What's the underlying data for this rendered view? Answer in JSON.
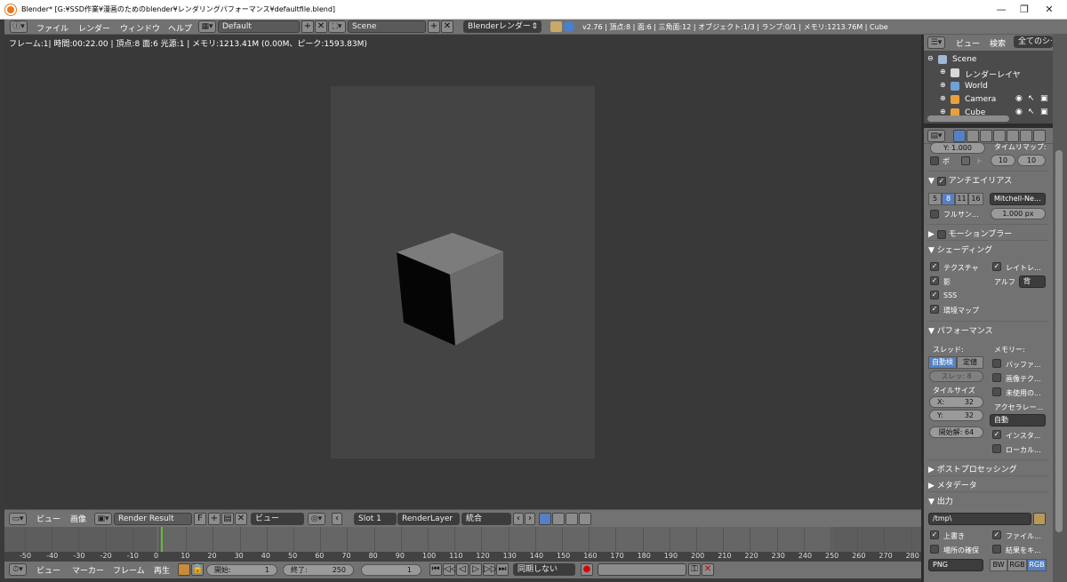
{
  "window": {
    "title": "Blender* [G:¥SSD作業¥漫画のためのblender¥レンダリングパフォーマンス¥defaultfile.blend]",
    "minimize": "—",
    "maximize": "❐",
    "close": "✕"
  },
  "menu": {
    "file": "ファイル",
    "render": "レンダー",
    "window": "ウィンドウ",
    "help": "ヘルプ"
  },
  "header": {
    "layout": "Default",
    "scene": "Scene",
    "engine": "Blenderレンダー",
    "stats": "v2.76 | 頂点:8 | 面:6 | 三角面:12 | オブジェクト:1/3 | ランプ:0/1 | メモリ:1213.76M | Cube"
  },
  "viewport": {
    "info": "フレーム:1| 時間:00:22.00 | 頂点:8 面:6 光源:1 | メモリ:1213.41M (0.00M、ピーク:1593.83M)"
  },
  "image_editor": {
    "view": "ビュー",
    "image": "画像",
    "image_name": "Render Result",
    "fake": "F",
    "view_mode": "ビュー",
    "slot": "Slot 1",
    "layer": "RenderLayer",
    "pass": "統合"
  },
  "timeline": {
    "ticks": [
      "-50",
      "-40",
      "-30",
      "-20",
      "-10",
      "0",
      "10",
      "20",
      "30",
      "40",
      "50",
      "60",
      "70",
      "80",
      "90",
      "100",
      "110",
      "120",
      "130",
      "140",
      "150",
      "160",
      "170",
      "180",
      "190",
      "200",
      "210",
      "220",
      "230",
      "240",
      "250",
      "260",
      "270",
      "280"
    ],
    "current_frame_value": 0
  },
  "timeline_toolbar": {
    "view": "ビュー",
    "marker": "マーカー",
    "frame": "フレーム",
    "playback": "再生",
    "start_label": "開始:",
    "start": "1",
    "end_label": "終了:",
    "end": "250",
    "current": "1",
    "sync": "同期しない"
  },
  "outliner": {
    "view": "ビュー",
    "search": "検索",
    "filter": "全てのシーン",
    "items": [
      {
        "label": "Scene",
        "icon": "scene-icon",
        "indent": 0
      },
      {
        "label": "レンダーレイヤ",
        "icon": "render-layers-icon",
        "indent": 1
      },
      {
        "label": "World",
        "icon": "world-icon",
        "indent": 1
      },
      {
        "label": "Camera",
        "icon": "camera-icon",
        "indent": 1
      },
      {
        "label": "Cube",
        "icon": "cube-icon",
        "indent": 1
      }
    ]
  },
  "props": {
    "y_label": "Y:",
    "y_value": "1.000",
    "time_remap": "タイムリマップ:",
    "remap_old": "10",
    "remap_new": "10",
    "border": "ボ",
    "crop": "ト",
    "aa": {
      "title": "アンチエイリアス",
      "samples": [
        "5",
        "8",
        "11",
        "16"
      ],
      "filter": "Mitchell-Ne...",
      "full_sample": "フルサン...",
      "size": "1.000 px"
    },
    "motion_blur": "モーションブラー",
    "shading": {
      "title": "シェーディング",
      "textures": "テクスチャ",
      "raytrace": "レイトレ...",
      "shadows": "影",
      "alpha_label": "アルフ",
      "alpha": "背",
      "sss": "SSS",
      "env_maps": "環境マップ"
    },
    "performance": {
      "title": "パフォーマンス",
      "threads": "スレッド:",
      "auto": "自動検",
      "fixed": "定値",
      "threads_count": "スレッ: 8",
      "memory": "メモリー:",
      "save_buffers": "バッファ...",
      "free_tex": "画像テク...",
      "free_unused": "未使用の...",
      "tile_size": "タイルサイズ",
      "x_label": "X:",
      "x": "32",
      "y_label": "Y:",
      "y": "32",
      "accel": "アクセラレー...",
      "accel_value": "自動",
      "instances": "インスタ...",
      "local_coords": "ローカル...",
      "start_res": "開始解: 64"
    },
    "post": "ポストプロセッシング",
    "metadata": "メタデータ",
    "output": {
      "title": "出力",
      "path": "/tmp\\",
      "overwrite": "上書き",
      "file_ext": "ファイル...",
      "placeholders": "場所の確保",
      "cache": "結果をキ...",
      "format": "PNG",
      "bw": "BW",
      "rgb": "RGB",
      "rgba": "RGB"
    }
  },
  "colors": {
    "selected": "#5680c2",
    "playhead": "#5fbf2f",
    "accent": "#e8781c"
  }
}
